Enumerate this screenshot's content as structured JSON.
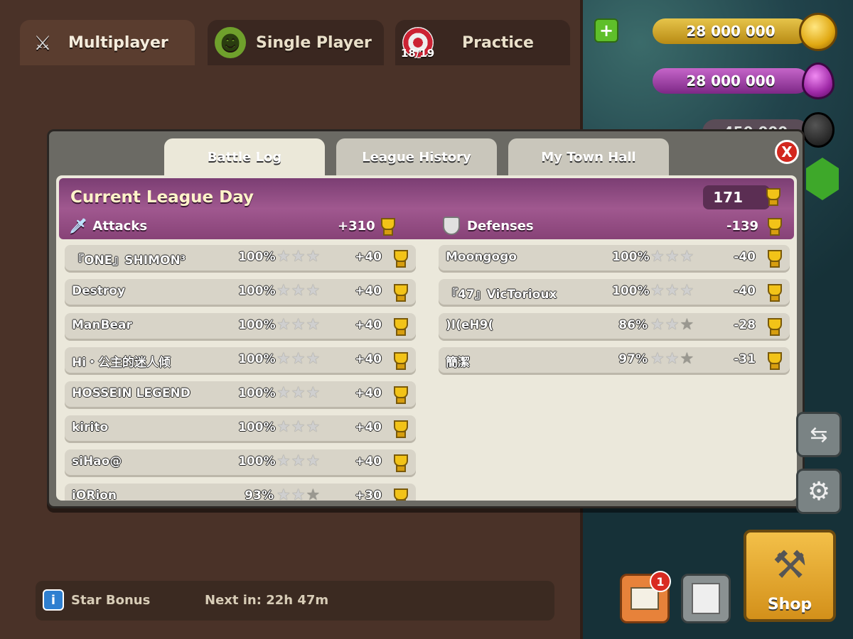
{
  "top_tabs": [
    {
      "label": "Multiplayer",
      "icon": "crossed-swords-icon"
    },
    {
      "label": "Single Player",
      "icon": "goblin-icon"
    },
    {
      "label": "Practice",
      "icon": "target-icon",
      "progress": "18/19"
    }
  ],
  "resources": {
    "gold": "28 000 000",
    "elixir": "28 000 000",
    "dark_elixir": "450 000"
  },
  "modal_tabs": [
    "Battle Log",
    "League History",
    "My Town Hall"
  ],
  "close_label": "X",
  "league": {
    "title": "Current League Day",
    "trophies": "171"
  },
  "attacks": {
    "label": "Attacks",
    "total": "+310",
    "rows": [
      {
        "name": "『ONE』SHIMON³",
        "pct": "100%",
        "stars": 3,
        "delta": "+40"
      },
      {
        "name": "Destroy",
        "pct": "100%",
        "stars": 3,
        "delta": "+40"
      },
      {
        "name": "ManBear",
        "pct": "100%",
        "stars": 3,
        "delta": "+40"
      },
      {
        "name": "Hi・公主的迷人倾",
        "pct": "100%",
        "stars": 3,
        "delta": "+40"
      },
      {
        "name": "HOSSEIN LEGEND",
        "pct": "100%",
        "stars": 3,
        "delta": "+40"
      },
      {
        "name": "kirito",
        "pct": "100%",
        "stars": 3,
        "delta": "+40"
      },
      {
        "name": "siHao@",
        "pct": "100%",
        "stars": 3,
        "delta": "+40"
      },
      {
        "name": "iORion",
        "pct": "93%",
        "stars": 2,
        "delta": "+30"
      }
    ]
  },
  "defenses": {
    "label": "Defenses",
    "total": "-139",
    "rows": [
      {
        "name": "Moongogo",
        "pct": "100%",
        "stars": 3,
        "delta": "-40"
      },
      {
        "name": "『47』VicTorioux",
        "pct": "100%",
        "stars": 3,
        "delta": "-40"
      },
      {
        "name": ")I(eH9(",
        "pct": "86%",
        "stars": 2,
        "delta": "-28"
      },
      {
        "name": "簡潔",
        "pct": "97%",
        "stars": 2,
        "delta": "-31"
      }
    ]
  },
  "star_bonus": {
    "label": "Star Bonus",
    "next": "Next in: 22h 47m"
  },
  "shop_label": "Shop",
  "notification_count": "1",
  "colors": {
    "league_bar": "#8f4a82",
    "gold": "#f2c318",
    "elixir": "#b23fb5",
    "panel": "#4a3228"
  }
}
